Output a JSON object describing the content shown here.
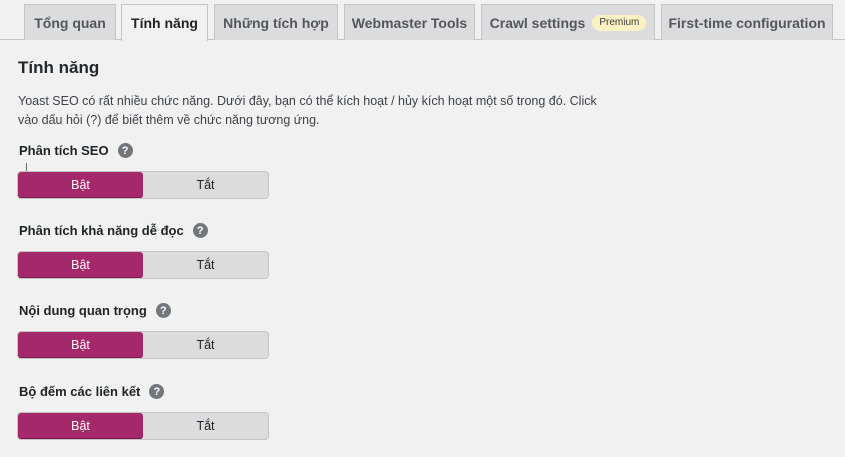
{
  "tabs": [
    {
      "label": "Tổng quan",
      "active": false
    },
    {
      "label": "Tính năng",
      "active": true
    },
    {
      "label": "Những tích hợp",
      "active": false
    },
    {
      "label": "Webmaster Tools",
      "active": false
    },
    {
      "label": "Crawl settings",
      "badge": "Premium",
      "active": false
    },
    {
      "label": "First-time configuration",
      "active": false
    }
  ],
  "section": {
    "title": "Tính năng",
    "intro": "Yoast SEO có rất nhiều chức năng. Dưới đây, bạn có thể kích hoạt / hủy kích hoạt một số trong đó. Click vào dấu hỏi (?) để biết thêm về chức năng tương ứng."
  },
  "features": [
    {
      "label": "Phân tích SEO",
      "help": "?",
      "on_label": "Bật",
      "off_label": "Tắt",
      "value": "on"
    },
    {
      "label": "Phân tích khả năng dễ đọc",
      "help": "?",
      "on_label": "Bật",
      "off_label": "Tắt",
      "value": "on"
    },
    {
      "label": "Nội dung quan trọng",
      "help": "?",
      "on_label": "Bật",
      "off_label": "Tắt",
      "value": "on"
    },
    {
      "label": "Bộ đếm các liên kết",
      "help": "?",
      "on_label": "Bật",
      "off_label": "Tắt",
      "value": "on"
    }
  ],
  "colors": {
    "accent": "#a4286a",
    "toggle_bg": "#dcdcde",
    "page_bg": "#f1f1f1",
    "badge_bg": "#fcf1c3"
  }
}
